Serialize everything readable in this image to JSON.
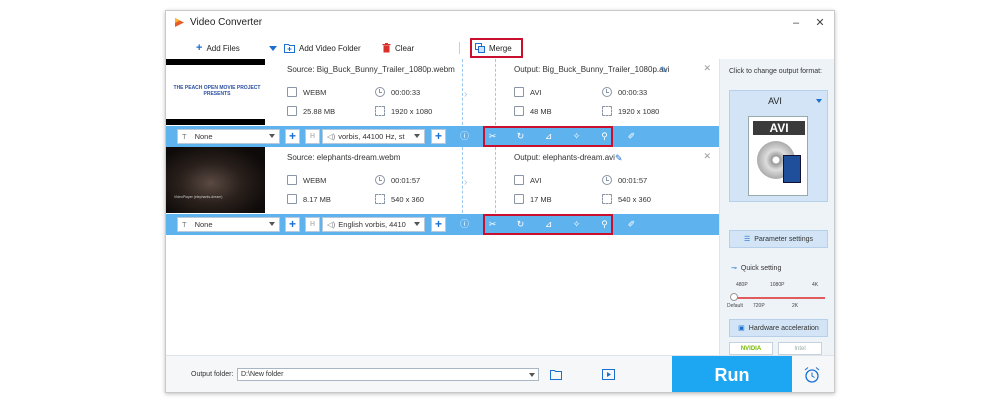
{
  "app": {
    "title": "Video Converter"
  },
  "toolbar": {
    "add_files": "Add Files",
    "add_video_folder": "Add Video Folder",
    "clear": "Clear",
    "merge": "Merge"
  },
  "files": [
    {
      "thumb_text": "THE PEACH OPEN MOVIE PROJECT PRESENTS",
      "source": "Source: Big_Buck_Bunny_Trailer_1080p.webm",
      "src_format": "WEBM",
      "src_duration": "00:00:33",
      "src_size": "25.88 MB",
      "src_resolution": "1920 x 1080",
      "output": "Output: Big_Buck_Bunny_Trailer_1080p.avi",
      "out_format": "AVI",
      "out_duration": "00:00:33",
      "out_size": "48 MB",
      "out_resolution": "1920 x 1080",
      "subtitle": "None",
      "audio": "vorbis, 44100 Hz, st"
    },
    {
      "thumb_text": "VideoPlayer (elephants-dream)",
      "source": "Source: elephants-dream.webm",
      "src_format": "WEBM",
      "src_duration": "00:01:57",
      "src_size": "8.17 MB",
      "src_resolution": "540 x 360",
      "output": "Output: elephants-dream.avi",
      "out_format": "AVI",
      "out_duration": "00:01:57",
      "out_size": "17 MB",
      "out_resolution": "540 x 360",
      "subtitle": "None",
      "audio": "English vorbis, 4410"
    }
  ],
  "right_panel": {
    "title": "Click to change output format:",
    "format": "AVI",
    "format_icon_text": "AVI",
    "parameter_settings": "Parameter settings",
    "quick_setting": "Quick setting",
    "quality_top": [
      "480P",
      "1080P",
      "4K"
    ],
    "quality_bottom": [
      "Default",
      "720P",
      "2K"
    ],
    "quality_level": 0,
    "hardware_acceleration": "Hardware acceleration",
    "nvidia": "NVIDIA",
    "intel": "Intel"
  },
  "bottom": {
    "output_folder_label": "Output folder:",
    "output_folder_value": "D:\\New folder",
    "run": "Run"
  },
  "colors": {
    "accent": "#1da6f2",
    "edit_bar": "#5eb2ee",
    "highlight": "#c8102e"
  }
}
